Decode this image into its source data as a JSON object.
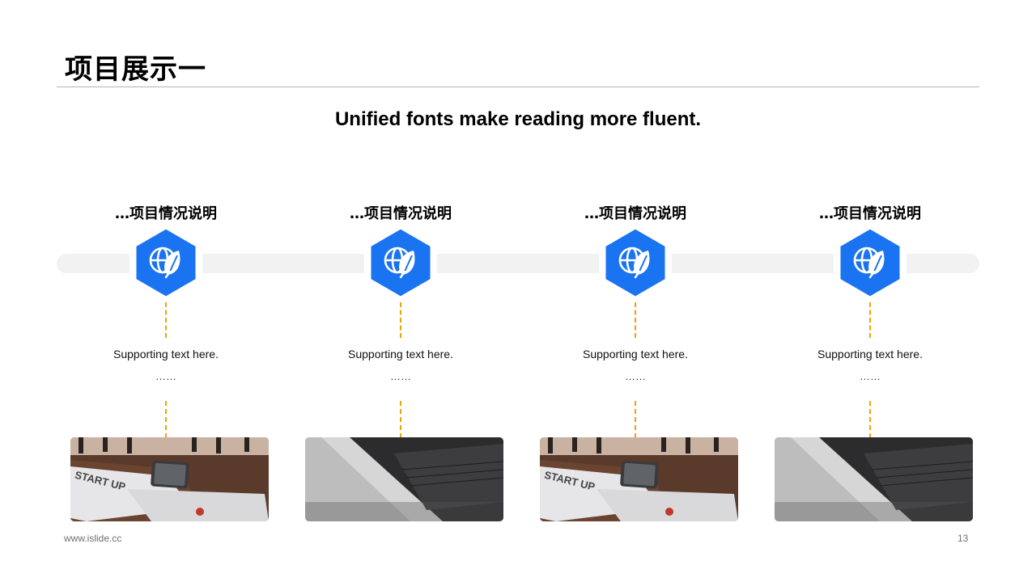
{
  "slide": {
    "title": "项目展示一",
    "subtitle": "Unified fonts make reading more fluent."
  },
  "colors": {
    "accent_blue": "#1a73f0",
    "dash_orange": "#f5a200",
    "track_gray": "#f2f2f2"
  },
  "steps": [
    {
      "title": "…项目情况说明",
      "icon": "globe-leaf-icon",
      "support": "Supporting text here.",
      "dots": "……",
      "photo": "desk-notebook-phone"
    },
    {
      "title": "…项目情况说明",
      "icon": "globe-leaf-icon",
      "support": "Supporting text here.",
      "dots": "……",
      "photo": "laptop-closeup"
    },
    {
      "title": "…项目情况说明",
      "icon": "globe-leaf-icon",
      "support": "Supporting text here.",
      "dots": "……",
      "photo": "desk-notebook-phone"
    },
    {
      "title": "…项目情况说明",
      "icon": "globe-leaf-icon",
      "support": "Supporting text here.",
      "dots": "……",
      "photo": "laptop-closeup"
    }
  ],
  "footer": {
    "url": "www.islide.cc",
    "page_number": "13"
  }
}
